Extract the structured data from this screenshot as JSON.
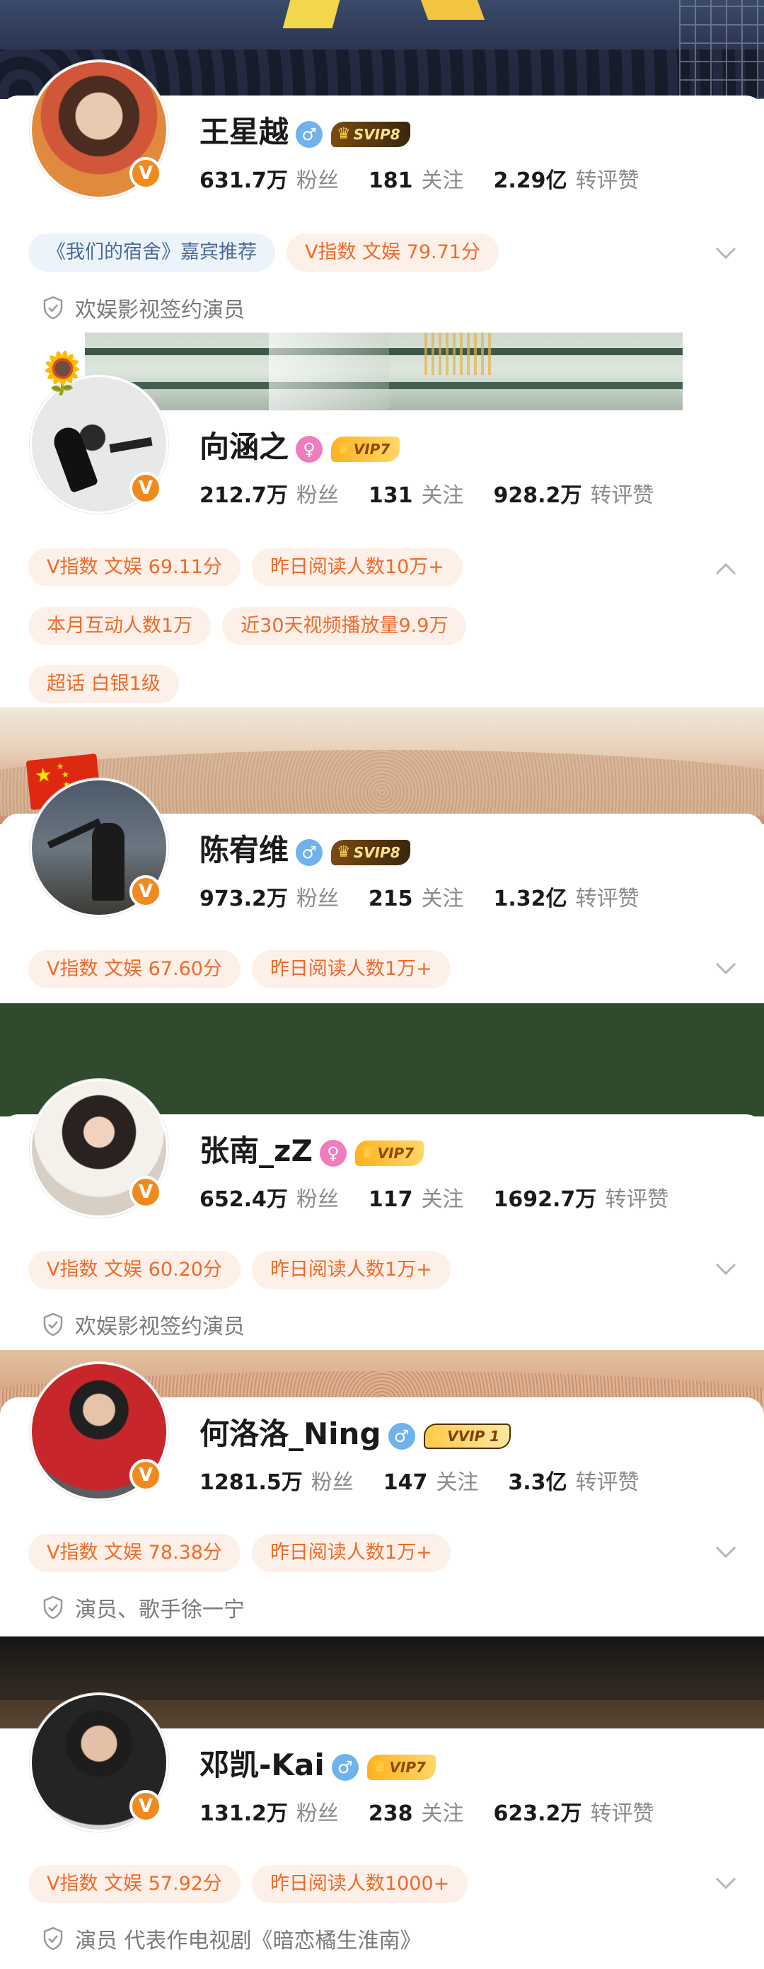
{
  "profiles": [
    {
      "name": "王星越",
      "gender": "♂",
      "vip": "SVIP8",
      "verify": "V",
      "followers_num": "631.7万",
      "followers_label": "粉丝",
      "following_num": "181",
      "following_label": "关注",
      "likes_num": "2.29亿",
      "likes_label": "转评赞",
      "tags": [
        "《我们的宿舍》嘉宾推荐",
        "V指数 文娱 79.71分"
      ],
      "cert": "欢娱影视签约演员"
    },
    {
      "name": "向涵之",
      "gender": "♀",
      "vip": "VIP7",
      "verify": "V",
      "followers_num": "212.7万",
      "followers_label": "粉丝",
      "following_num": "131",
      "following_label": "关注",
      "likes_num": "928.2万",
      "likes_label": "转评赞",
      "tags": [
        "V指数 文娱 69.11分",
        "昨日阅读人数10万+"
      ],
      "tags2": [
        "本月互动人数1万",
        "近30天视频播放量9.9万"
      ],
      "tags3": [
        "超话 白银1级"
      ],
      "sticker": "🌻"
    },
    {
      "name": "陈宥维",
      "gender": "♂",
      "vip": "SVIP8",
      "verify": "V",
      "followers_num": "973.2万",
      "followers_label": "粉丝",
      "following_num": "215",
      "following_label": "关注",
      "likes_num": "1.32亿",
      "likes_label": "转评赞",
      "tags": [
        "V指数 文娱 67.60分",
        "昨日阅读人数1万+"
      ],
      "sticker": "★"
    },
    {
      "name": "张南_zZ",
      "gender": "♀",
      "vip": "VIP7",
      "verify": "V",
      "followers_num": "652.4万",
      "followers_label": "粉丝",
      "following_num": "117",
      "following_label": "关注",
      "likes_num": "1692.7万",
      "likes_label": "转评赞",
      "tags": [
        "V指数 文娱 60.20分",
        "昨日阅读人数1万+"
      ],
      "cert": "欢娱影视签约演员"
    },
    {
      "name": "何洛洛_Ning",
      "gender": "♂",
      "vip": "VVIP 1",
      "verify": "V",
      "followers_num": "1281.5万",
      "followers_label": "粉丝",
      "following_num": "147",
      "following_label": "关注",
      "likes_num": "3.3亿",
      "likes_label": "转评赞",
      "tags": [
        "V指数 文娱 78.38分",
        "昨日阅读人数1万+"
      ],
      "cert": "演员、歌手徐一宁"
    },
    {
      "name": "邓凯-Kai",
      "gender": "♂",
      "vip": "VIP7",
      "verify": "V",
      "followers_num": "131.2万",
      "followers_label": "粉丝",
      "following_num": "238",
      "following_label": "关注",
      "likes_num": "623.2万",
      "likes_label": "转评赞",
      "tags": [
        "V指数 文娱 57.92分",
        "昨日阅读人数1000+"
      ],
      "cert": "演员 代表作电视剧《暗恋橘生淮南》"
    }
  ],
  "icons": {
    "crown": "♛",
    "shield": "shield-check-icon",
    "chevron_down": "chevron-down-icon",
    "chevron_up": "chevron-up-icon"
  },
  "colors": {
    "tag_orange_text": "#ef6a2a",
    "tag_orange_bg": "#fdf0e8",
    "tag_blue_text": "#4a6b95",
    "verify_orange": "#f08a1f",
    "male_blue": "#6fb2ec",
    "female_pink": "#ef7dbb"
  }
}
